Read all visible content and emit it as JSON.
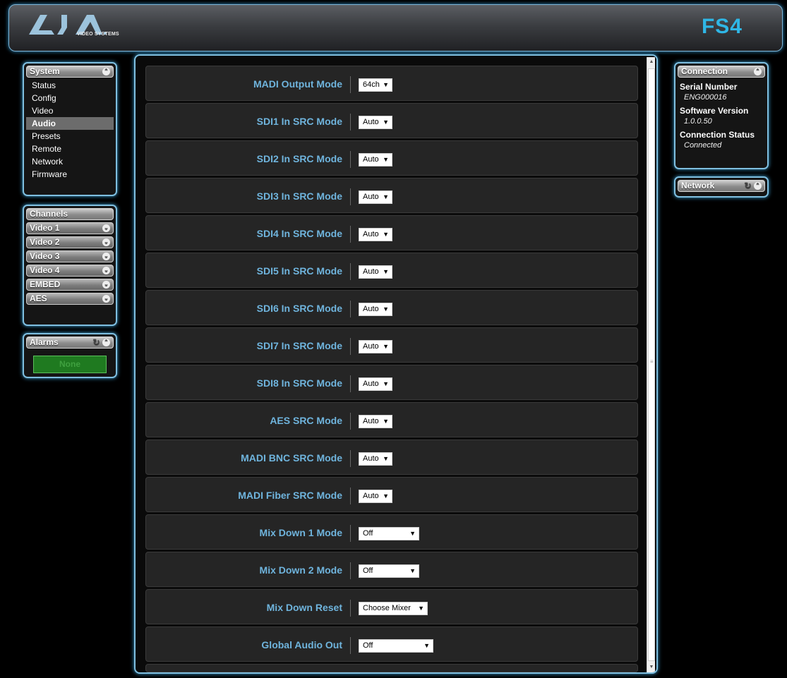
{
  "header": {
    "logo_text": "AJA",
    "logo_subtitle": "VIDEO SYSTEMS",
    "product": "FS4"
  },
  "system": {
    "title": "System",
    "items": [
      {
        "label": "Status"
      },
      {
        "label": "Config"
      },
      {
        "label": "Video"
      },
      {
        "label": "Audio"
      },
      {
        "label": "Presets"
      },
      {
        "label": "Remote"
      },
      {
        "label": "Network"
      },
      {
        "label": "Firmware"
      }
    ],
    "active": "Audio"
  },
  "channels": {
    "title": "Channels",
    "items": [
      {
        "label": "Video 1"
      },
      {
        "label": "Video 2"
      },
      {
        "label": "Video 3"
      },
      {
        "label": "Video 4"
      },
      {
        "label": "EMBED"
      },
      {
        "label": "AES"
      }
    ]
  },
  "alarms": {
    "title": "Alarms",
    "status": "None"
  },
  "settings": [
    {
      "label": "MADI Output Mode",
      "value": "64ch"
    },
    {
      "label": "SDI1 In SRC Mode",
      "value": "Auto"
    },
    {
      "label": "SDI2 In SRC Mode",
      "value": "Auto"
    },
    {
      "label": "SDI3 In SRC Mode",
      "value": "Auto"
    },
    {
      "label": "SDI4 In SRC Mode",
      "value": "Auto"
    },
    {
      "label": "SDI5 In SRC Mode",
      "value": "Auto"
    },
    {
      "label": "SDI6 In SRC Mode",
      "value": "Auto"
    },
    {
      "label": "SDI7 In SRC Mode",
      "value": "Auto"
    },
    {
      "label": "SDI8 In SRC Mode",
      "value": "Auto"
    },
    {
      "label": "AES SRC Mode",
      "value": "Auto"
    },
    {
      "label": "MADI BNC SRC Mode",
      "value": "Auto"
    },
    {
      "label": "MADI Fiber SRC Mode",
      "value": "Auto"
    },
    {
      "label": "Mix Down 1 Mode",
      "value": "Off"
    },
    {
      "label": "Mix Down 2 Mode",
      "value": "Off"
    },
    {
      "label": "Mix Down Reset",
      "value": "Choose Mixer"
    },
    {
      "label": "Global Audio Out",
      "value": "Off"
    }
  ],
  "connection": {
    "title": "Connection",
    "serial_label": "Serial Number",
    "serial_value": "ENG000016",
    "software_label": "Software Version",
    "software_value": "1.0.0.50",
    "status_label": "Connection Status",
    "status_value": "Connected"
  },
  "network": {
    "title": "Network"
  },
  "colors": {
    "accent": "#7fbfe0",
    "label_blue": "#6fb4dd",
    "product_blue": "#2fb7e6",
    "alarm_green": "#1f7a20"
  },
  "icons": {
    "collapse": "chevron-circle-icon",
    "refresh": "refresh-icon"
  }
}
